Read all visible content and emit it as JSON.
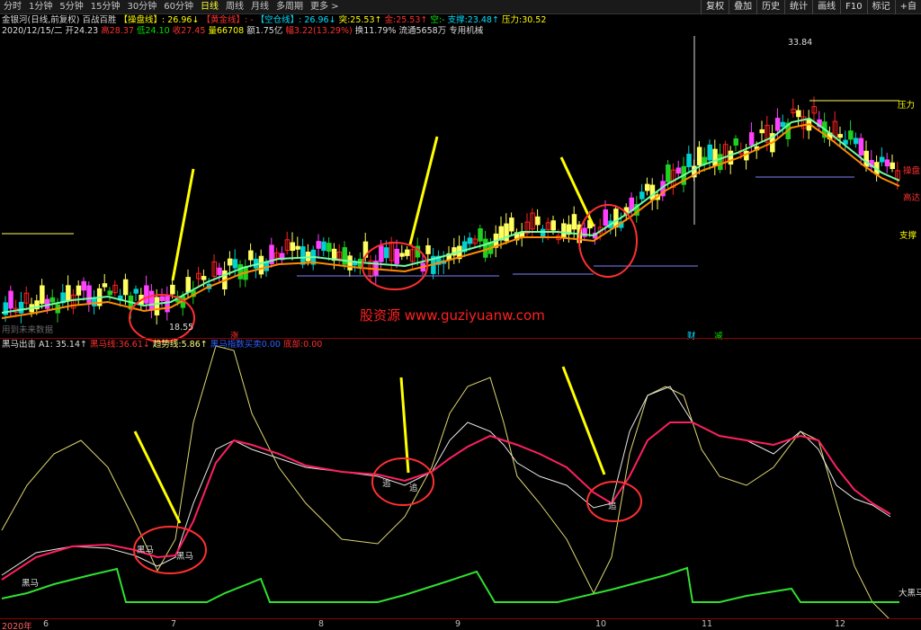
{
  "toolbar": {
    "periods": [
      "分时",
      "1分钟",
      "5分钟",
      "15分钟",
      "30分钟",
      "60分钟",
      "日线",
      "周线",
      "月线",
      "多周期",
      "更多 >"
    ],
    "active": "日线",
    "buttons": [
      "复权",
      "叠加",
      "历史",
      "统计",
      "画线",
      "F10",
      "标记",
      "+自"
    ]
  },
  "info1": {
    "stock": "金银河(日线,前复权)",
    "formula": "百战百胜",
    "op_line_label": "【操盘线】",
    "op_line_value": ": 26.96↓",
    "gold_line_label": "【黄金线】",
    "gold_line_value": ": -",
    "empty_line_label": "【空仓线】",
    "empty_line_value": ": 26.96↓",
    "tu_label": "突:",
    "tu_value": "25.53↑",
    "jin_label": "金:",
    "jin_value": "25.53↑",
    "kong_label": "空:",
    "kong_value": "-",
    "support_label": "支撑:",
    "support_value": "23.48↑",
    "pressure_label": "压力:",
    "pressure_value": "30.52"
  },
  "info2": {
    "date": "2020/12/15/二",
    "open": "开24.23",
    "high": "高28.37",
    "low": "低24.10",
    "close": "收27.45",
    "volume": "量66708",
    "amount": "额1.75亿",
    "change": "幅3.22(13.29%)",
    "turnover": "换11.79%",
    "float": "流通5658万",
    "sector": "专用机械"
  },
  "info3": {
    "name": "黑马出击",
    "a1": "A1: 35.14↑",
    "hm_label": "黑马线:",
    "hm_value": "36.61↓",
    "trend_label": "趋势线:",
    "trend_value": "5.86↑",
    "index_label": "黑马指数买卖",
    "index_value": "0.00",
    "bottom_label": "底部:",
    "bottom_value": "0.00"
  },
  "watermark": "股资源 www.guziyuanw.com",
  "price_labels": {
    "high": "33.84",
    "low": "18.55",
    "pressure": "压力",
    "support": "支撑",
    "op": "操盘",
    "attack": "高达",
    "legend_note": "用到未来数据"
  },
  "markers": {
    "zhang": "涨",
    "cai": "财",
    "jian": "减",
    "zhui": "追",
    "heima": "黑马",
    "daheima": "大黑马"
  },
  "axis_labels": [
    "2020年",
    "6",
    "7",
    "8",
    "9",
    "10",
    "11",
    "12"
  ],
  "chart_data": {
    "type": "candlestick",
    "date": "2020/12/15",
    "open": 24.23,
    "high": 28.37,
    "low": 24.1,
    "close": 27.45,
    "period_high": 33.84,
    "period_low": 18.55,
    "support": 23.48,
    "pressure": 30.52
  }
}
